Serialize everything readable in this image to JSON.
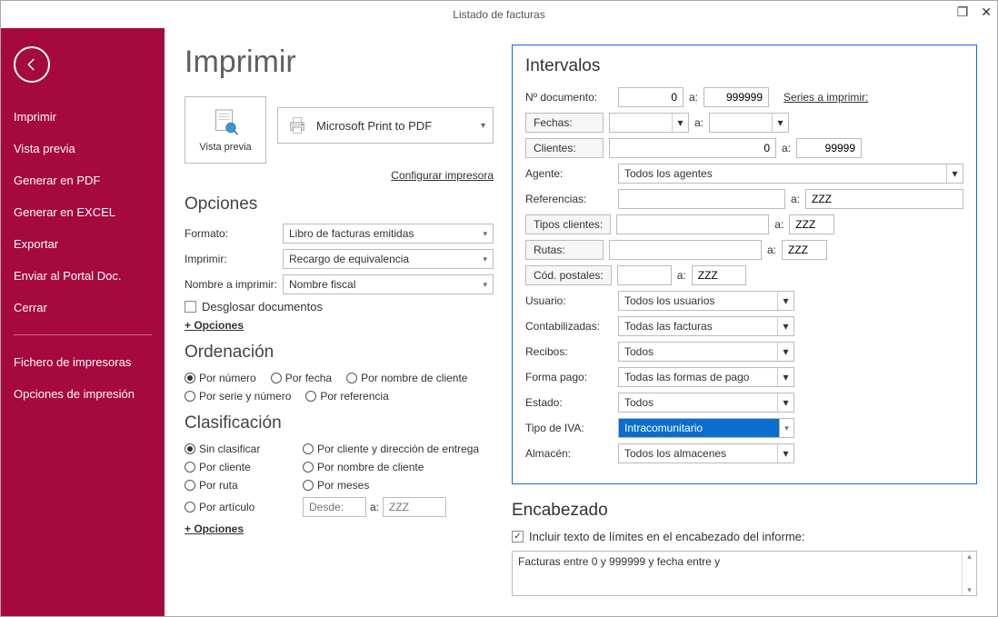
{
  "window": {
    "title": "Listado de facturas"
  },
  "sidebar": {
    "items": [
      "Imprimir",
      "Vista previa",
      "Generar en PDF",
      "Generar en EXCEL",
      "Exportar",
      "Enviar al Portal Doc.",
      "Cerrar"
    ],
    "extra": [
      "Fichero de impresoras",
      "Opciones de impresión"
    ]
  },
  "main": {
    "title": "Imprimir",
    "preview_label": "Vista previa",
    "printer_name": "Microsoft Print to PDF",
    "config_printer": "Configurar impresora"
  },
  "opciones": {
    "title": "Opciones",
    "formato_label": "Formato:",
    "formato_value": "Libro de facturas emitidas",
    "imprimir_label": "Imprimir:",
    "imprimir_value": "Recargo de equivalencia",
    "nombre_label": "Nombre a imprimir:",
    "nombre_value": "Nombre fiscal",
    "desglosar": "Desglosar documentos",
    "mas": "+ Opciones"
  },
  "ordenacion": {
    "title": "Ordenación",
    "items": [
      "Por número",
      "Por fecha",
      "Por nombre de cliente",
      "Por serie y número",
      "Por referencia"
    ],
    "selected": 0
  },
  "clasificacion": {
    "title": "Clasificación",
    "col1": [
      "Sin clasificar",
      "Por cliente",
      "Por ruta",
      "Por artículo"
    ],
    "col2": [
      "Por cliente y dirección de entrega",
      "Por nombre de cliente",
      "Por meses"
    ],
    "selected": 0,
    "desde_ph": "Desde:",
    "a_label": "a:",
    "zzz_ph": "ZZZ",
    "mas": "+ Opciones"
  },
  "intervalos": {
    "title": "Intervalos",
    "ndoc_label": "Nº documento:",
    "ndoc_from": "0",
    "a": "a:",
    "ndoc_to": "999999",
    "series": "Series a imprimir:",
    "fechas": "Fechas:",
    "clientes": "Clientes:",
    "clientes_from": "0",
    "clientes_to": "99999",
    "agente_label": "Agente:",
    "agente_value": "Todos los agentes",
    "referencias_label": "Referencias:",
    "referencias_to": "ZZZ",
    "tipos_clientes": "Tipos clientes:",
    "tipos_to": "ZZZ",
    "rutas": "Rutas:",
    "rutas_to": "ZZZ",
    "cod_postales": "Cód. postales:",
    "cod_to": "ZZZ",
    "usuario_label": "Usuario:",
    "usuario_value": "Todos los usuarios",
    "contab_label": "Contabilizadas:",
    "contab_value": "Todas las facturas",
    "recibos_label": "Recibos:",
    "recibos_value": "Todos",
    "forma_label": "Forma pago:",
    "forma_value": "Todas las formas de pago",
    "estado_label": "Estado:",
    "estado_value": "Todos",
    "iva_label": "Tipo de IVA:",
    "iva_value": "Intracomunitario",
    "almacen_label": "Almacén:",
    "almacen_value": "Todos los almacenes"
  },
  "encabezado": {
    "title": "Encabezado",
    "check_label": "Incluir texto de límites en el encabezado del informe:",
    "text": "Facturas entre 0 y 999999 y fecha entre  y"
  }
}
